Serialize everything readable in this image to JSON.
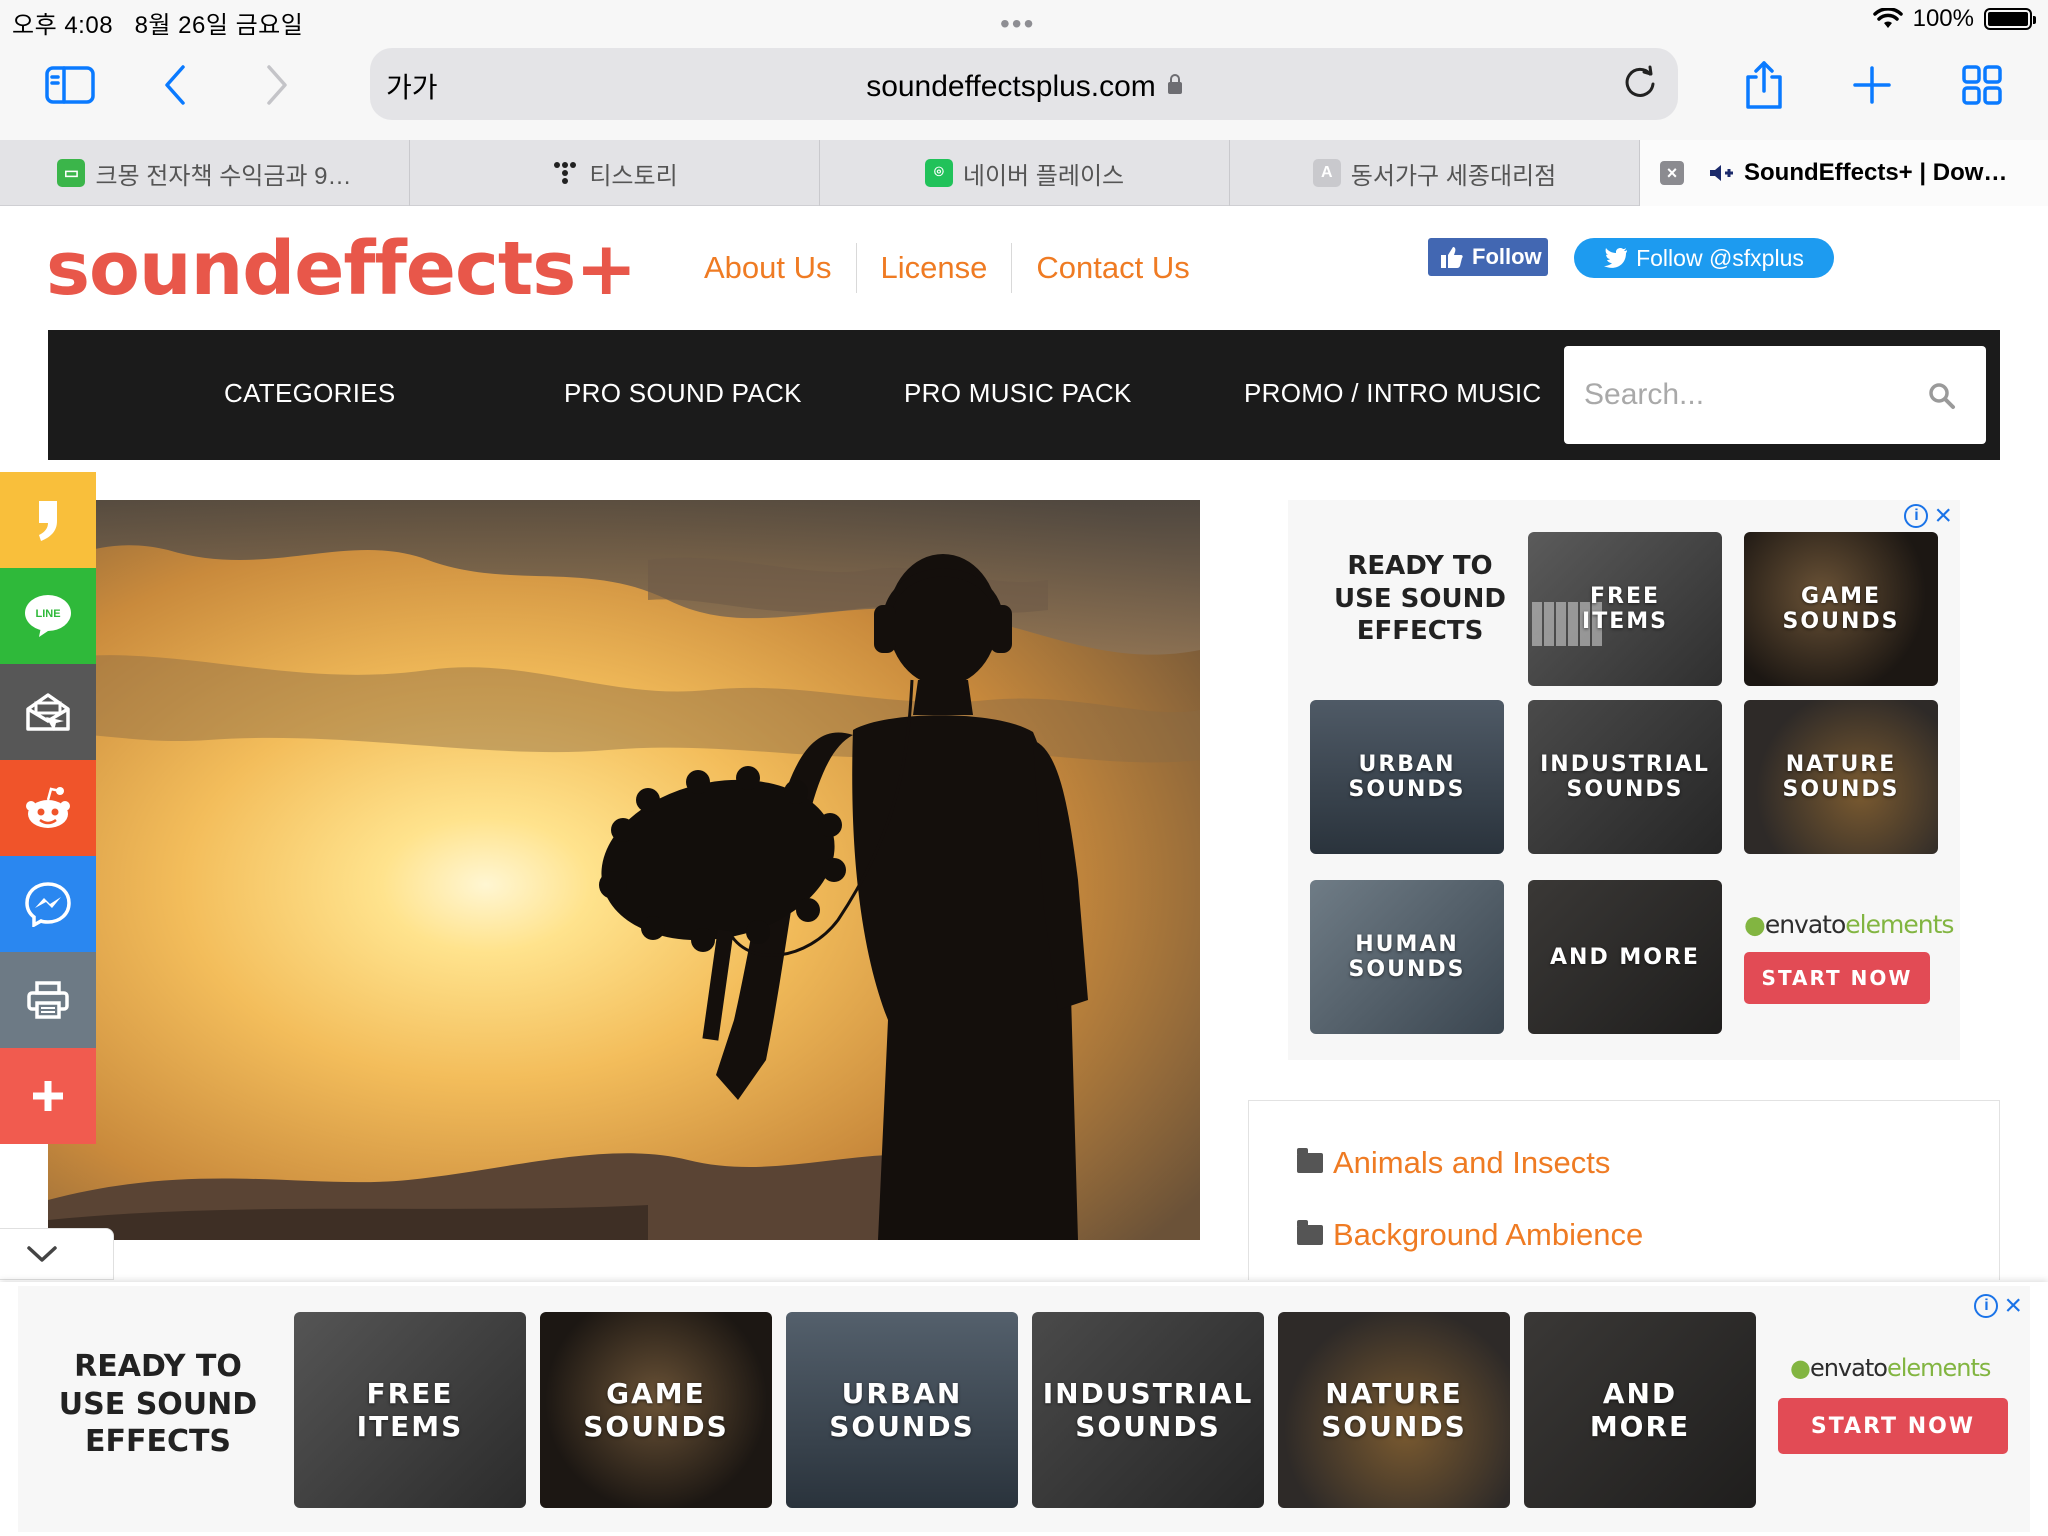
{
  "status_bar": {
    "time": "오후 4:08",
    "date": "8월 26일 금요일",
    "battery": "100%"
  },
  "browser": {
    "text_size_label": "가가",
    "url": "soundeffectsplus.com",
    "tabs": [
      {
        "label": "크몽 전자책 수익금과 9…",
        "icon": "kmong-icon"
      },
      {
        "label": "티스토리",
        "icon": "tistory-icon"
      },
      {
        "label": "네이버 플레이스",
        "icon": "naver-place-icon"
      },
      {
        "label": "동서가구 세종대리점",
        "icon": "letter-a-icon"
      },
      {
        "label": "SoundEffects+ | Dow…",
        "icon": "soundeffects-favicon",
        "active": true
      }
    ],
    "tab_icon_letter": "A"
  },
  "site": {
    "logo": "soundeffects+",
    "top_links": [
      "About Us",
      "License",
      "Contact Us"
    ],
    "facebook_follow": "Follow",
    "twitter_follow": "Follow @sfxplus",
    "main_nav": [
      "CATEGORIES",
      "PRO SOUND PACK",
      "PRO MUSIC PACK",
      "PROMO / INTRO MUSIC"
    ],
    "search_placeholder": "Search...",
    "colors": {
      "brand": "#e8574a",
      "link": "#ef7b23",
      "nav_bg": "#1b1b1b"
    }
  },
  "share_bar": [
    {
      "icon": "kakao-story-icon",
      "color": "#f9bf3b"
    },
    {
      "icon": "line-icon",
      "color": "#2fb93a"
    },
    {
      "icon": "email-icon",
      "color": "#575757"
    },
    {
      "icon": "reddit-icon",
      "color": "#f0542a"
    },
    {
      "icon": "messenger-icon",
      "color": "#2a87f0"
    },
    {
      "icon": "print-icon",
      "color": "#6d7a85"
    },
    {
      "icon": "more-plus-icon",
      "color": "#f15b4f"
    }
  ],
  "line_label": "LINE",
  "ad_right": {
    "headline": "READY TO\nUSE SOUND\nEFFECTS",
    "tiles": [
      "FREE\nITEMS",
      "GAME\nSOUNDS",
      "URBAN\nSOUNDS",
      "INDUSTRIAL\nSOUNDS",
      "NATURE\nSOUNDS",
      "HUMAN\nSOUNDS",
      "AND MORE"
    ],
    "brand_part1": "envato",
    "brand_part2": "elements",
    "cta": "START NOW",
    "info_icon": "i"
  },
  "categories": [
    "Animals and Insects",
    "Background Ambience"
  ],
  "ad_bottom": {
    "headline": "READY TO\nUSE SOUND\nEFFECTS",
    "tiles": [
      "FREE\nITEMS",
      "GAME\nSOUNDS",
      "URBAN\nSOUNDS",
      "INDUSTRIAL\nSOUNDS",
      "NATURE\nSOUNDS",
      "AND\nMORE"
    ],
    "brand_part1": "envato",
    "brand_part2": "elements",
    "cta": "START NOW"
  }
}
